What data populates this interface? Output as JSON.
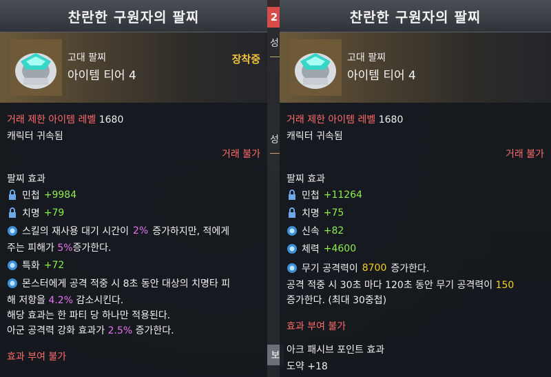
{
  "strip": {
    "badge": "2",
    "char_top": "성",
    "char_mid": "성",
    "tab": "보"
  },
  "left": {
    "title": "찬란한 구원자의 팔찌",
    "item_type": "고대 팔찌",
    "item_tier": "아이템 티어 4",
    "equipped_label": "장착중",
    "req_level_label": "거래 제한 아이템 레벨",
    "req_level_value": "1680",
    "bound": "캐릭터 귀속됨",
    "trade": "거래 불가",
    "effect_header": "팔찌 효과",
    "stats": [
      {
        "icon": "lock-icon",
        "name": "민첩",
        "value": "+9984"
      },
      {
        "icon": "lock-icon",
        "name": "치명",
        "value": "+79"
      }
    ],
    "special1": {
      "icon": "gear-icon",
      "a": "스킬의 재사용 대기 시간이",
      "b": "2%",
      "c": "증가하지만, 적에게",
      "d": "주는 피해가",
      "e": "5%",
      "f": "증가한다."
    },
    "stat3": {
      "icon": "gear-icon",
      "name": "특화",
      "value": "+72"
    },
    "special2": {
      "icon": "gear-icon",
      "a": "몬스터에게 공격 적중 시 8초 동안 대상의 치명타 피",
      "b": "해 저항을",
      "c": "4.2%",
      "d": "감소시킨다.",
      "e": "해당 효과는 한 파티 당 하나만 적용된다.",
      "f": "아군 공격력 강화 효과가",
      "g": "2.5%",
      "h": "증가한다."
    },
    "no_effect": "효과 부여 불가"
  },
  "right": {
    "title": "찬란한 구원자의 팔찌",
    "item_type": "고대 팔찌",
    "item_tier": "아이템 티어 4",
    "req_level_label": "거래 제한 아이템 레벨",
    "req_level_value": "1680",
    "bound": "캐릭터 귀속됨",
    "trade": "거래 불가",
    "effect_header": "팔찌 효과",
    "stats": [
      {
        "icon": "lock-icon",
        "name": "민첩",
        "value": "+11264"
      },
      {
        "icon": "lock-icon",
        "name": "치명",
        "value": "+75"
      },
      {
        "icon": "gear-icon",
        "name": "신속",
        "value": "+82"
      },
      {
        "icon": "gear-icon",
        "name": "체력",
        "value": "+4600"
      }
    ],
    "special": {
      "icon": "gear-icon",
      "a": "무기 공격력이",
      "b": "8700",
      "c": "증가한다.",
      "d": "공격 적중 시 30초 마다 120초 동안 무기 공격력이",
      "e": "150",
      "f": "증가한다. (최대 30중첩)"
    },
    "no_effect": "효과 부여 불가",
    "ark_header": "아크 패시브 포인트 효과",
    "ark_line": "도약 +18"
  }
}
